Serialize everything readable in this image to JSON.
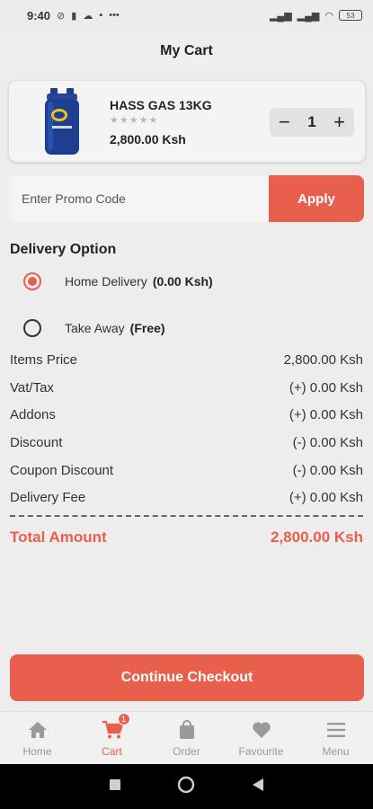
{
  "status_bar": {
    "time": "9:40",
    "battery": "53"
  },
  "header": {
    "title": "My Cart"
  },
  "cart": {
    "items": [
      {
        "name": "HASS GAS 13KG",
        "stars": "★★★★★",
        "price": "2,800.00 Ksh",
        "quantity": "1"
      }
    ]
  },
  "promo": {
    "placeholder": "Enter Promo Code",
    "apply_label": "Apply"
  },
  "delivery": {
    "title": "Delivery Option",
    "options": [
      {
        "label": "Home Delivery",
        "price": "(0.00 Ksh)",
        "selected": true
      },
      {
        "label": "Take Away",
        "price": "(Free)",
        "selected": false
      }
    ]
  },
  "summary": {
    "rows": [
      {
        "label": "Items Price",
        "value": "2,800.00 Ksh"
      },
      {
        "label": "Vat/Tax",
        "value": "(+) 0.00 Ksh"
      },
      {
        "label": "Addons",
        "value": "(+) 0.00 Ksh"
      },
      {
        "label": "Discount",
        "value": "(-) 0.00 Ksh"
      },
      {
        "label": "Coupon Discount",
        "value": "(-) 0.00 Ksh"
      },
      {
        "label": "Delivery Fee",
        "value": "(+) 0.00 Ksh"
      }
    ],
    "total_label": "Total Amount",
    "total_value": "2,800.00 Ksh"
  },
  "checkout": {
    "label": "Continue Checkout"
  },
  "bottom_nav": {
    "items": [
      {
        "label": "Home",
        "icon": "home-icon"
      },
      {
        "label": "Cart",
        "icon": "cart-icon",
        "badge": "1",
        "active": true
      },
      {
        "label": "Order",
        "icon": "bag-icon"
      },
      {
        "label": "Favourite",
        "icon": "heart-icon"
      },
      {
        "label": "Menu",
        "icon": "menu-icon"
      }
    ]
  },
  "colors": {
    "accent": "#e8604c",
    "background": "#ededed",
    "inactive": "#9a9a9a"
  }
}
